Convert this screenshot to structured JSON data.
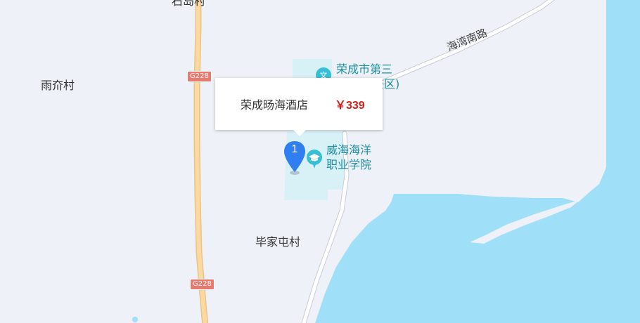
{
  "map": {
    "colors": {
      "land": "#eef1f7",
      "water": "#9fe0f8",
      "campus": "#d7f1f7",
      "highway": "#fbd9a0",
      "road": "#ffffff"
    },
    "places": [
      {
        "id": "top-village",
        "name": "石岛村"
      },
      {
        "id": "yujie",
        "name": "雨夼村"
      },
      {
        "id": "bijia",
        "name": "毕家屯村"
      }
    ],
    "roads": [
      {
        "id": "haiwan",
        "name": "海湾南路"
      }
    ],
    "route_shields": [
      "G228",
      "G228"
    ],
    "pois": [
      {
        "id": "school-3",
        "icon": "school-icon",
        "lines": [
          "荣成市第三",
          "校区)"
        ]
      },
      {
        "id": "weihai-college",
        "icon": "graduation-cap-icon",
        "lines": [
          "威海海洋",
          "职业学院"
        ]
      }
    ]
  },
  "popup": {
    "hotel_name": "荣成旸海酒店",
    "price": "￥339"
  },
  "marker": {
    "number": "1"
  }
}
